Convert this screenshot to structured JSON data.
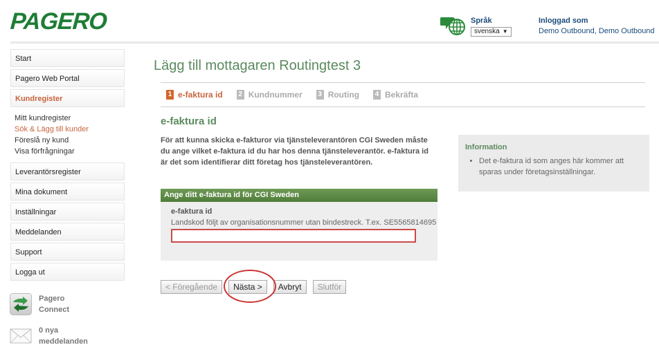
{
  "brand": {
    "logo_text": "PAGERO",
    "color": "#1e7d35"
  },
  "header": {
    "language_label": "Språk",
    "language_selected": "svenska",
    "logged_in_label": "Inloggad som",
    "logged_in_user": "Demo Outbound, Demo Outbound"
  },
  "sidebar": {
    "items": [
      {
        "label": "Start"
      },
      {
        "label": "Pagero Web Portal"
      },
      {
        "label": "Kundregister",
        "active": true
      },
      {
        "label": "Leverantörsregister"
      },
      {
        "label": "Mina dokument"
      },
      {
        "label": "Inställningar"
      },
      {
        "label": "Meddelanden"
      },
      {
        "label": "Support"
      },
      {
        "label": "Logga ut"
      }
    ],
    "sub_items": [
      {
        "label": "Mitt kundregister"
      },
      {
        "label": "Sök & Lägg till kunder",
        "active": true
      },
      {
        "label": "Föreslå ny kund"
      },
      {
        "label": "Visa förfrågningar"
      }
    ],
    "widgets": {
      "connect": {
        "line1": "Pagero",
        "line2": "Connect",
        "icon": "pagero-connect-icon"
      },
      "messages": {
        "line1": "0 nya",
        "line2": "meddelanden",
        "icon": "envelope-icon"
      }
    }
  },
  "main": {
    "title": "Lägg till mottagaren Routingtest 3",
    "steps": [
      {
        "num": "1",
        "label": "e-faktura id",
        "active": true
      },
      {
        "num": "2",
        "label": "Kundnummer"
      },
      {
        "num": "3",
        "label": "Routing"
      },
      {
        "num": "4",
        "label": "Bekräfta"
      }
    ],
    "section_title": "e-faktura id",
    "intro": "För att kunna skicka e-fakturor via tjänsteleverantören CGI Sweden måste du ange vilket e-faktura id du har hos denna tjänsteleverantör. e-faktura id är det som identifierar ditt företag hos tjänsteleverantören.",
    "form": {
      "header": "Ange ditt e-faktura id för CGI Sweden",
      "field_label": "e-faktura id",
      "field_hint": "Landskod följt av organisationsnummer utan bindestreck. T.ex. SE5565814695",
      "field_value": ""
    },
    "buttons": {
      "previous": "< Föregående",
      "next": "Nästa >",
      "cancel": "Avbryt",
      "finish": "Slutför"
    },
    "info": {
      "title": "Information",
      "items": [
        "Det e-faktura id som anges här kommer att sparas under företagsinställningar."
      ]
    }
  },
  "colors": {
    "accent_green": "#5a8a5e",
    "active_orange": "#c8643c",
    "panel_header_green": "#5f8c48",
    "highlight_red": "#cc3333"
  }
}
